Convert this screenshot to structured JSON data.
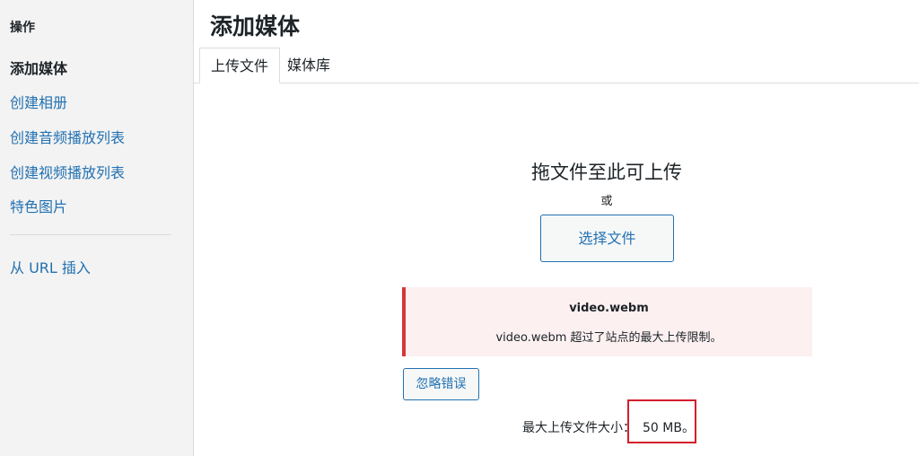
{
  "sidebar": {
    "heading": "操作",
    "items": [
      {
        "label": "添加媒体",
        "active": true
      },
      {
        "label": "创建相册",
        "active": false
      },
      {
        "label": "创建音频播放列表",
        "active": false
      },
      {
        "label": "创建视频播放列表",
        "active": false
      },
      {
        "label": "特色图片",
        "active": false
      }
    ],
    "url_insert": "从 URL 插入"
  },
  "header": {
    "title": "添加媒体"
  },
  "tabs": [
    {
      "label": "上传文件",
      "active": true
    },
    {
      "label": "媒体库",
      "active": false
    }
  ],
  "upload": {
    "drop_title": "拖文件至此可上传",
    "or_text": "或",
    "select_button": "选择文件"
  },
  "error": {
    "filename": "video.webm",
    "message": "video.webm 超过了站点的最大上传限制。",
    "dismiss_button": "忽略错误"
  },
  "max_upload": {
    "label": "最大上传文件大小：",
    "value": "50 MB。"
  },
  "colors": {
    "link": "#2271b1",
    "error_border": "#d63638",
    "error_bg": "#fcf0f1",
    "highlight": "#d21f2b"
  }
}
